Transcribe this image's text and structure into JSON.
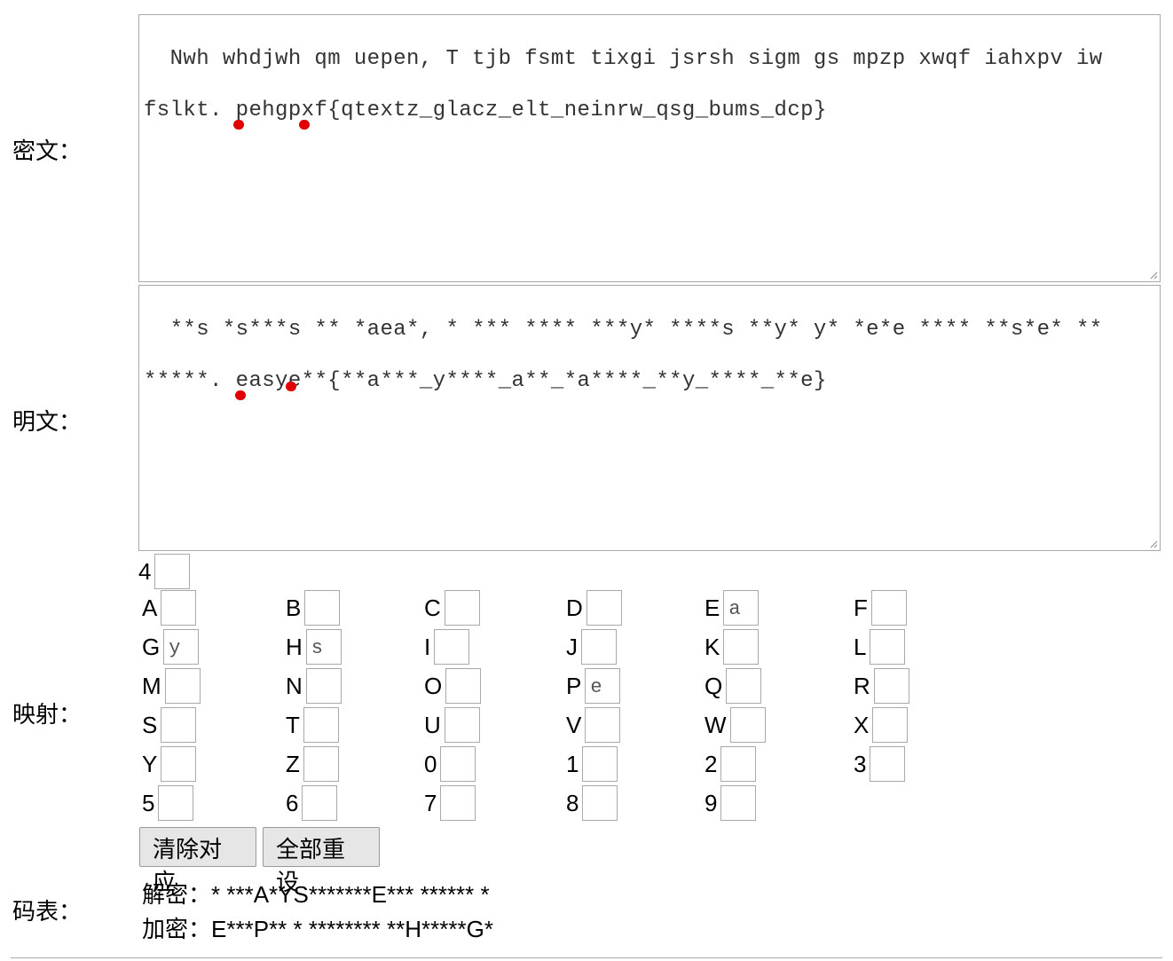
{
  "labels": {
    "ciphertext": "密文：",
    "plaintext": "明文：",
    "mapping": "映射：",
    "codetable": "码表："
  },
  "ciphertext": {
    "line1": "Nwh whdjwh qm uepen, T tjb fsmt tixgi jsrsh sigm gs mpzp xwqf iahxpv iw",
    "line2_pre": "fslkt. ",
    "line2_u1": "p",
    "line2_mid": "ehgp",
    "line2_u2": "x",
    "line2_post": "f{qtextz_glacz_elt_neinrw_qsg_bums_dcp}"
  },
  "plaintext": {
    "line1": "**s *s***s ** *aea*, * *** **** ***y* ****s **y* y* *e*e **** **s*e* **",
    "line2_pre": "*****. ",
    "line2_u1": "e",
    "line2_mid": "asy",
    "line2_u2": "e",
    "line2_post": "**{**a***_y****_a**_*a****_**y_****_**e}"
  },
  "mapping": [
    {
      "char": "4",
      "value": ""
    },
    {
      "char": "A",
      "value": ""
    },
    {
      "char": "B",
      "value": ""
    },
    {
      "char": "C",
      "value": ""
    },
    {
      "char": "D",
      "value": ""
    },
    {
      "char": "E",
      "value": "a"
    },
    {
      "char": "F",
      "value": ""
    },
    {
      "char": "G",
      "value": "y"
    },
    {
      "char": "H",
      "value": "s"
    },
    {
      "char": "I",
      "value": ""
    },
    {
      "char": "J",
      "value": ""
    },
    {
      "char": "K",
      "value": ""
    },
    {
      "char": "L",
      "value": ""
    },
    {
      "char": "M",
      "value": ""
    },
    {
      "char": "N",
      "value": ""
    },
    {
      "char": "O",
      "value": ""
    },
    {
      "char": "P",
      "value": "e"
    },
    {
      "char": "Q",
      "value": ""
    },
    {
      "char": "R",
      "value": ""
    },
    {
      "char": "S",
      "value": ""
    },
    {
      "char": "T",
      "value": ""
    },
    {
      "char": "U",
      "value": ""
    },
    {
      "char": "V",
      "value": ""
    },
    {
      "char": "W",
      "value": ""
    },
    {
      "char": "X",
      "value": ""
    },
    {
      "char": "Y",
      "value": ""
    },
    {
      "char": "Z",
      "value": ""
    },
    {
      "char": "0",
      "value": ""
    },
    {
      "char": "1",
      "value": ""
    },
    {
      "char": "2",
      "value": ""
    },
    {
      "char": "3",
      "value": ""
    },
    {
      "char": "5",
      "value": ""
    },
    {
      "char": "6",
      "value": ""
    },
    {
      "char": "7",
      "value": ""
    },
    {
      "char": "8",
      "value": ""
    },
    {
      "char": "9",
      "value": ""
    }
  ],
  "buttons": {
    "clear": "清除对应",
    "reset": "全部重设"
  },
  "codetable": {
    "decrypt": "解密：* ***A*YS*******E*** ****** *",
    "encrypt": "加密：E***P** * ******** **H*****G*"
  },
  "colors": {
    "annotation_dot": "#e00000"
  }
}
